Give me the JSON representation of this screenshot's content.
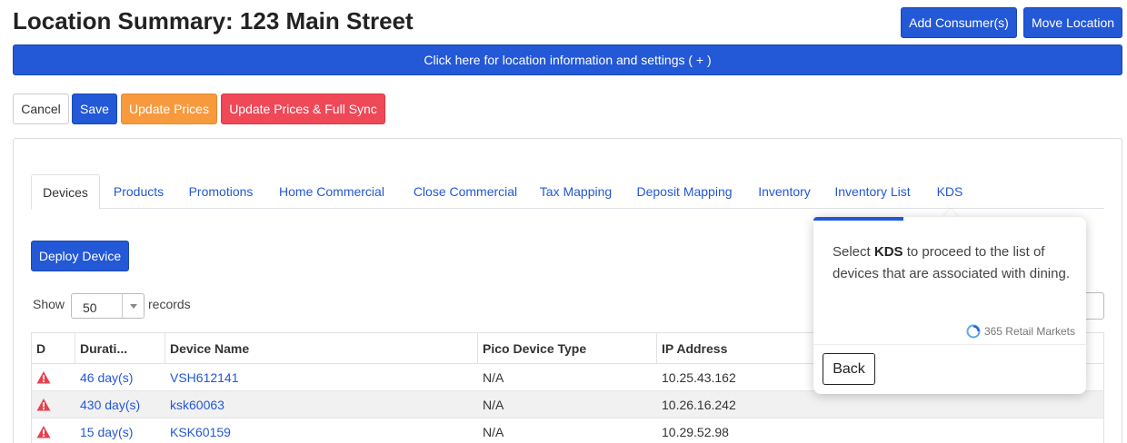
{
  "header": {
    "title": "Location Summary: 123 Main Street",
    "add_consumers_label": "Add Consumer(s)",
    "move_location_label": "Move Location"
  },
  "banner": {
    "text": "Click here for location information and settings ( + )"
  },
  "actions": {
    "cancel_label": "Cancel",
    "save_label": "Save",
    "update_prices_label": "Update Prices",
    "update_full_sync_label": "Update Prices & Full Sync"
  },
  "tabs": [
    {
      "label": "Devices",
      "active": true
    },
    {
      "label": "Products"
    },
    {
      "label": "Promotions"
    },
    {
      "label": "Home Commercial"
    },
    {
      "label": "Close Commercial"
    },
    {
      "label": "Tax Mapping"
    },
    {
      "label": "Deposit Mapping"
    },
    {
      "label": "Inventory"
    },
    {
      "label": "Inventory List"
    },
    {
      "label": "KDS"
    }
  ],
  "deploy_button_label": "Deploy Device",
  "length_menu": {
    "show_label": "Show",
    "value": "50",
    "records_label": "records"
  },
  "table": {
    "headers": [
      "D",
      "Durati...",
      "Device Name",
      "Pico Device Type",
      "IP Address"
    ],
    "rows": [
      {
        "duration": "46 day(s)",
        "device_name": "VSH612141",
        "pico_type": "N/A",
        "ip": "10.25.43.162"
      },
      {
        "duration": "430 day(s)",
        "device_name": "ksk60063",
        "pico_type": "N/A",
        "ip": "10.26.16.242"
      },
      {
        "duration": "15 day(s)",
        "device_name": "KSK60159",
        "pico_type": "N/A",
        "ip": "10.29.52.98"
      }
    ]
  },
  "tour": {
    "text_before": "Select ",
    "text_bold": "KDS",
    "text_after": " to proceed to the list of devices that are associated with dining.",
    "brand": "365 Retail Markets",
    "back_label": "Back",
    "progress_fraction": 0.33
  },
  "colors": {
    "primary": "#2358d6",
    "warning_orange": "#f79a3e",
    "danger_red": "#ef4857",
    "alert_icon": "#e5414f"
  },
  "icons": {
    "status": "warning-triangle-icon",
    "brand": "365-logo-icon",
    "dropdown": "chevron-down-icon"
  }
}
